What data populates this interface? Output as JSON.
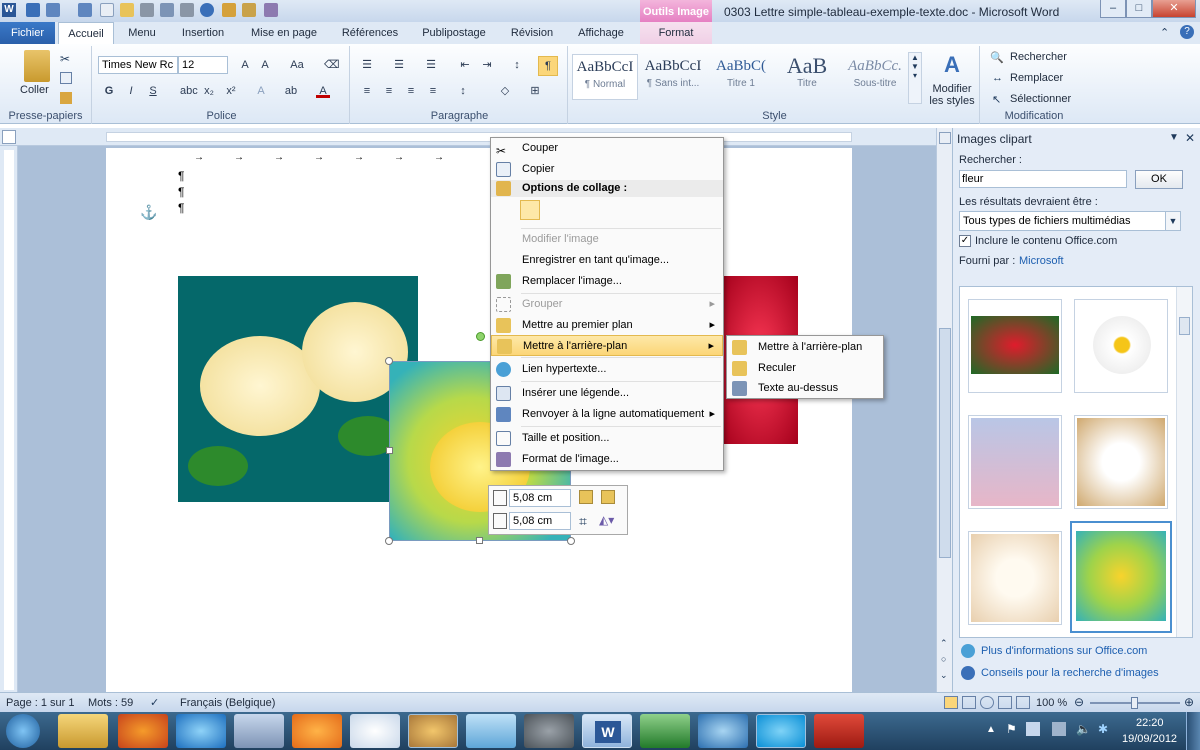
{
  "window": {
    "title": "0303 Lettre simple-tableau-exemple-texte.doc - Microsoft Word",
    "context_tab_group": "Outils Image"
  },
  "tabs": [
    "Fichier",
    "Accueil",
    "Menu",
    "Insertion",
    "Mise en page",
    "Références",
    "Publipostage",
    "Révision",
    "Affichage",
    "Format"
  ],
  "ribbon": {
    "clipboard": {
      "label": "Presse-papiers",
      "paste": "Coller"
    },
    "font": {
      "label": "Police",
      "name": "Times New Rc",
      "size": "12"
    },
    "paragraph": {
      "label": "Paragraphe"
    },
    "styles": {
      "label": "Style",
      "items": [
        {
          "preview": "AaBbCcI",
          "name": "¶ Normal"
        },
        {
          "preview": "AaBbCcI",
          "name": "¶ Sans int..."
        },
        {
          "preview": "AaBbC(",
          "name": "Titre 1"
        },
        {
          "preview": "AaB",
          "name": "Titre"
        },
        {
          "preview": "AaBbCc.",
          "name": "Sous-titre"
        }
      ],
      "change": "Modifier les styles"
    },
    "editing": {
      "label": "Modification",
      "find": "Rechercher",
      "replace": "Remplacer",
      "select": "Sélectionner"
    }
  },
  "context_menu": {
    "items": [
      {
        "label": "Couper",
        "icon": "scissors-icon"
      },
      {
        "label": "Copier",
        "icon": "copy-icon"
      },
      {
        "label": "Options de collage :",
        "icon": "paste-options-icon",
        "header": true
      },
      {
        "label": "Modifier l'image",
        "disabled": true
      },
      {
        "label": "Enregistrer en tant qu'image..."
      },
      {
        "label": "Remplacer l'image...",
        "icon": "replace-image-icon"
      },
      {
        "label": "Grouper",
        "disabled": true,
        "submenu": true,
        "icon": "group-icon"
      },
      {
        "label": "Mettre au premier plan",
        "submenu": true,
        "icon": "bring-front-icon"
      },
      {
        "label": "Mettre à l'arrière-plan",
        "submenu": true,
        "highlighted": true,
        "icon": "send-back-icon"
      },
      {
        "label": "Lien hypertexte...",
        "icon": "hyperlink-icon"
      },
      {
        "label": "Insérer une légende...",
        "icon": "caption-icon"
      },
      {
        "label": "Renvoyer à la ligne automatiquement",
        "submenu": true,
        "icon": "wrap-icon"
      },
      {
        "label": "Taille et position...",
        "icon": "size-icon"
      },
      {
        "label": "Format de l'image...",
        "icon": "format-image-icon"
      }
    ],
    "submenu": [
      "Mettre à l'arrière-plan",
      "Reculer",
      "Texte au-dessus"
    ]
  },
  "mini_toolbar": {
    "height": "5,08 cm",
    "width": "5,08 cm"
  },
  "clipart_pane": {
    "title": "Images clipart",
    "search_label": "Rechercher :",
    "search_value": "fleur",
    "ok": "OK",
    "results_label": "Les résultats devraient être :",
    "results_value": "Tous types de fichiers multimédias",
    "include_office": "Inclure le contenu Office.com",
    "provided_by": "Fourni par :",
    "provider": "Microsoft",
    "link_more": "Plus d'informations sur Office.com",
    "link_tips": "Conseils pour la recherche d'images"
  },
  "status": {
    "page": "Page : 1 sur 1",
    "words": "Mots : 59",
    "language": "Français (Belgique)",
    "zoom": "100 %"
  },
  "clock": {
    "time": "22:20",
    "date": "19/09/2012"
  }
}
